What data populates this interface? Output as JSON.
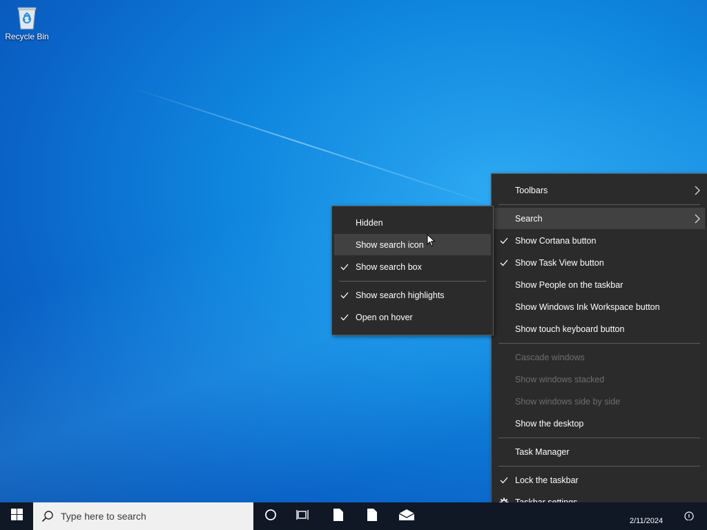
{
  "desktop": {
    "recycle_bin_label": "Recycle Bin"
  },
  "context_menu": {
    "items": {
      "toolbars": "Toolbars",
      "search": "Search",
      "show_cortana": "Show Cortana button",
      "show_task_view": "Show Task View button",
      "show_people": "Show People on the taskbar",
      "show_ink": "Show Windows Ink Workspace button",
      "show_touch_keyboard": "Show touch keyboard button",
      "cascade": "Cascade windows",
      "stacked": "Show windows stacked",
      "side_by_side": "Show windows side by side",
      "show_desktop": "Show the desktop",
      "task_manager": "Task Manager",
      "lock_taskbar": "Lock the taskbar",
      "taskbar_settings": "Taskbar settings"
    },
    "checked": [
      "show_cortana",
      "show_task_view",
      "lock_taskbar"
    ]
  },
  "search_submenu": {
    "items": {
      "hidden": "Hidden",
      "show_icon": "Show search icon",
      "show_box": "Show search box",
      "highlights": "Show search highlights",
      "open_hover": "Open on hover"
    },
    "checked": [
      "show_box",
      "highlights",
      "open_hover"
    ],
    "highlighted": "show_icon"
  },
  "taskbar": {
    "search_placeholder": "Type here to search",
    "date": "2/11/2024"
  },
  "colors": {
    "menu_bg": "#2b2b2b",
    "menu_highlight": "#414141",
    "taskbar_bg": "#101826",
    "disabled_text": "#6e6e6e"
  },
  "icons": [
    "recycle-bin-icon",
    "windows-logo-icon",
    "search-icon",
    "cortana-icon",
    "task-view-icon",
    "file-icon",
    "mail-icon",
    "chevron-right-icon",
    "checkmark-icon",
    "gear-icon",
    "notification-icon",
    "cursor-icon"
  ]
}
